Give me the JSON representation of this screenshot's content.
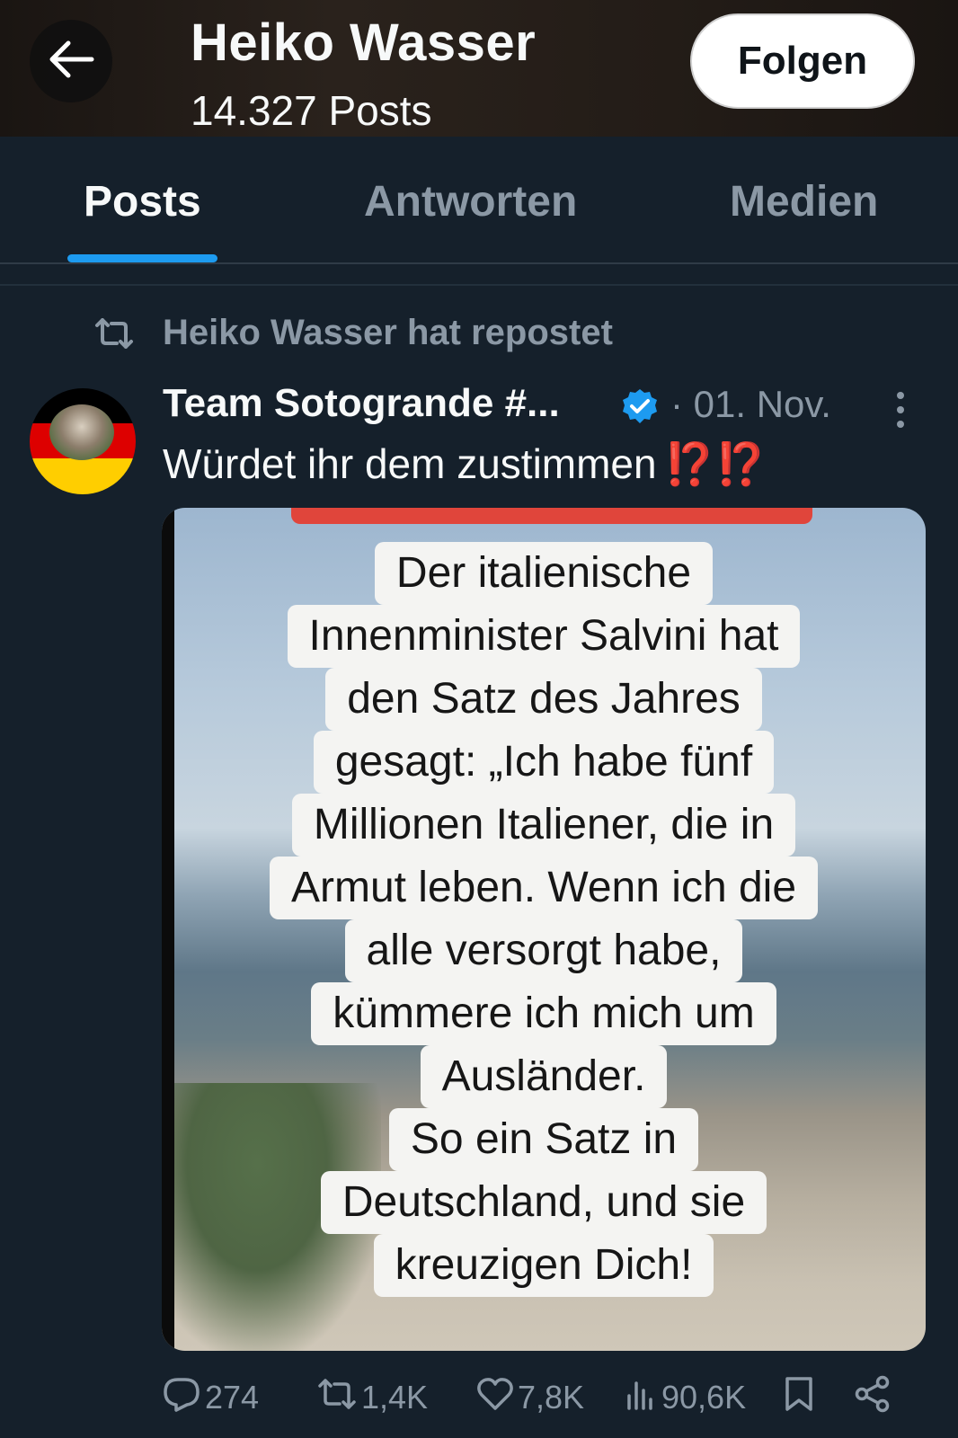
{
  "header": {
    "back_icon": "arrow-left-icon",
    "title": "Heiko Wasser",
    "subtitle": "14.327 Posts",
    "follow_label": "Folgen"
  },
  "tabs": [
    {
      "label": "Posts",
      "active": true
    },
    {
      "label": "Antworten",
      "active": false
    },
    {
      "label": "Medien",
      "active": false
    }
  ],
  "repost": {
    "icon": "repost-icon",
    "label": "Heiko Wasser hat repostet"
  },
  "post": {
    "author": "Team Sotogrande #...",
    "verified": true,
    "date": "· 01. Nov.",
    "text": "Würdet ihr dem zustimmen",
    "text_emoji": "⁉️⁉️",
    "image_lines": [
      "Der italienische",
      "Innenminister Salvini hat",
      "den Satz des Jahres",
      "gesagt: „Ich habe fünf",
      "Millionen Italiener, die in",
      "Armut leben. Wenn ich die",
      "alle versorgt habe,",
      "kümmere ich mich um",
      "Ausländer.",
      "So ein Satz in",
      "Deutschland, und sie",
      "kreuzigen Dich!"
    ],
    "actions": {
      "replies": "274",
      "reposts": "1,4K",
      "likes": "7,8K",
      "views": "90,6K"
    }
  },
  "colors": {
    "background": "#15202b",
    "accent": "#1d9bf0",
    "muted": "#8b98a5",
    "emphasis": "#f4212e"
  }
}
